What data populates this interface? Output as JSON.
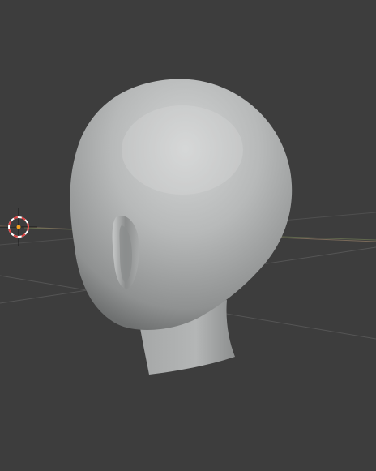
{
  "viewport": {
    "background": "#3d3d3d",
    "mesh_color": "#b9bbbb",
    "grid_line_color": "#5a5a5a",
    "x_axis_color": "#7a6a5a",
    "y_axis_color": "#6f7a55",
    "cursor_color_a": "#e04040",
    "cursor_color_b": "#ffffff"
  },
  "objects": [
    {
      "name": "head-mesh",
      "icon": "sculpt-head"
    },
    {
      "name": "3d-cursor",
      "icon": "cursor-crosshair"
    }
  ]
}
